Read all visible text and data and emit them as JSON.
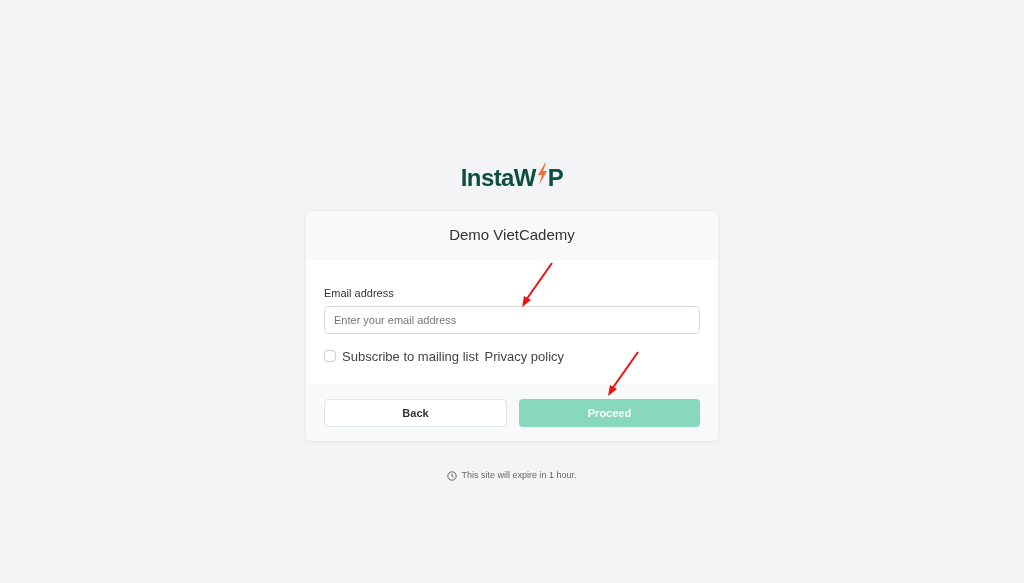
{
  "logo": {
    "text_start": "InstaW",
    "text_end": "P"
  },
  "card": {
    "title": "Demo VietCademy",
    "email": {
      "label": "Email address",
      "placeholder": "Enter your email address"
    },
    "subscribe": {
      "label": "Subscribe to mailing list",
      "checked": false
    },
    "privacy_link": "Privacy policy",
    "buttons": [
      {
        "label": "Back",
        "kind": "secondary",
        "disabled": false
      },
      {
        "label": "Proceed",
        "kind": "primary",
        "disabled": true
      }
    ]
  },
  "footer_note": "This site will expire in 1 hour."
}
